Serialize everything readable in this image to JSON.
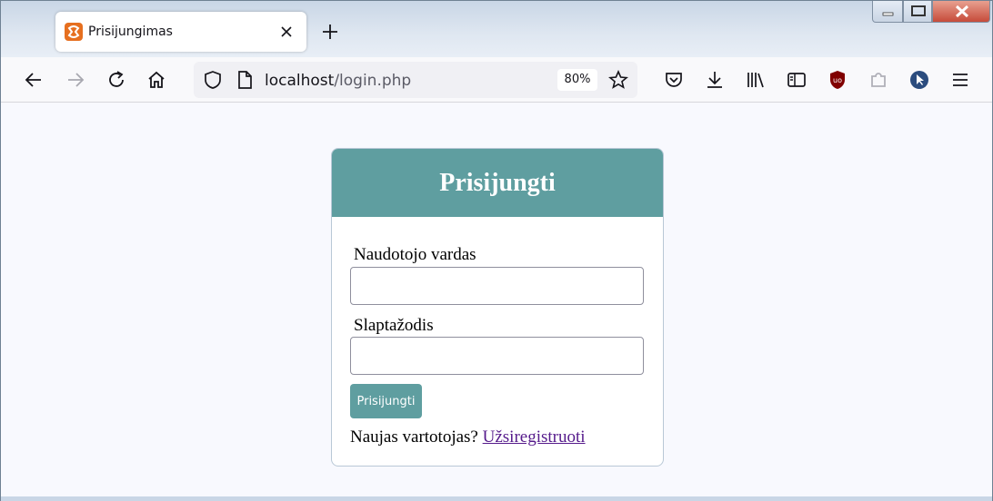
{
  "browser": {
    "tab": {
      "title": "Prisijungimas",
      "favicon": "xampp-icon"
    },
    "url": {
      "host": "localhost",
      "path": "/login.php"
    },
    "zoom": "80%",
    "toolbar_icons": [
      "back-icon",
      "forward-icon",
      "reload-icon",
      "home-icon",
      "shield-icon",
      "page-icon",
      "star-icon",
      "pocket-icon",
      "download-icon",
      "library-icon",
      "reader-icon",
      "ublock-icon",
      "extension-icon",
      "cursor-icon",
      "menu-icon"
    ]
  },
  "page": {
    "title": "Prisijungti",
    "username_label": "Naudotojo vardas",
    "username_value": "",
    "password_label": "Slaptažodis",
    "password_value": "",
    "submit_label": "Prisijungti",
    "register_prompt": "Naujas vartotojas?",
    "register_link": "Užsiregistruoti"
  },
  "colors": {
    "accent": "#5f9ea0",
    "link": "#551a8b"
  }
}
